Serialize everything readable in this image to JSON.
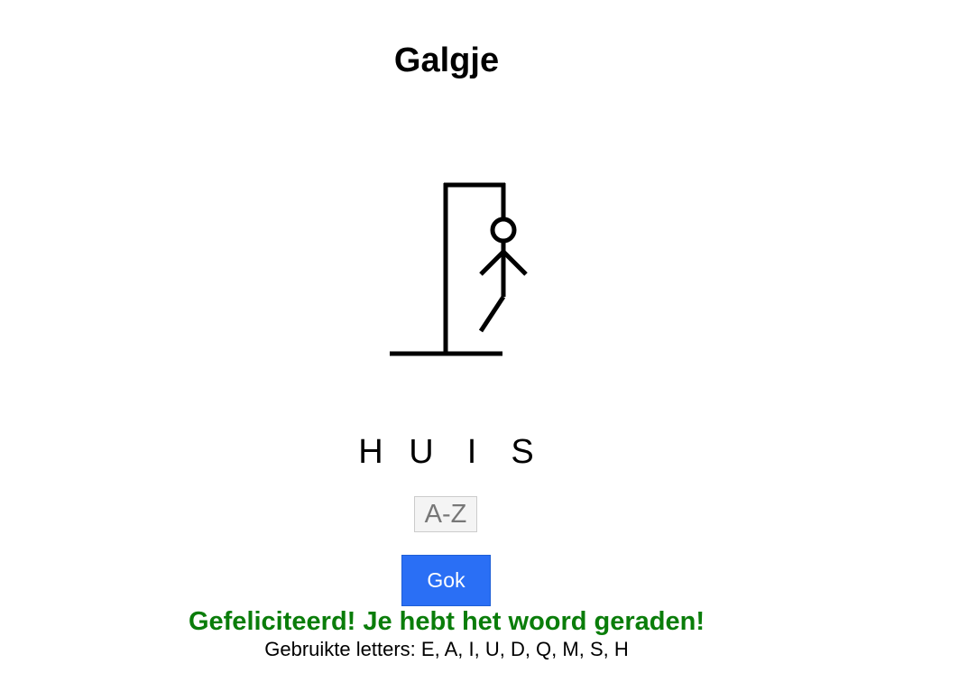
{
  "title": "Galgje",
  "word_letters": [
    "H",
    "U",
    "I",
    "S"
  ],
  "input": {
    "value": "",
    "placeholder": "A-Z"
  },
  "guess_button_label": "Gok",
  "message": "Gefeliciteerd! Je hebt het woord geraden!",
  "used_letters": {
    "label": "Gebruikte letters:",
    "letters": "E, A, I, U, D, Q, M, S, H"
  },
  "colors": {
    "accent": "#2a6ff5",
    "success": "#0a7d0a"
  }
}
